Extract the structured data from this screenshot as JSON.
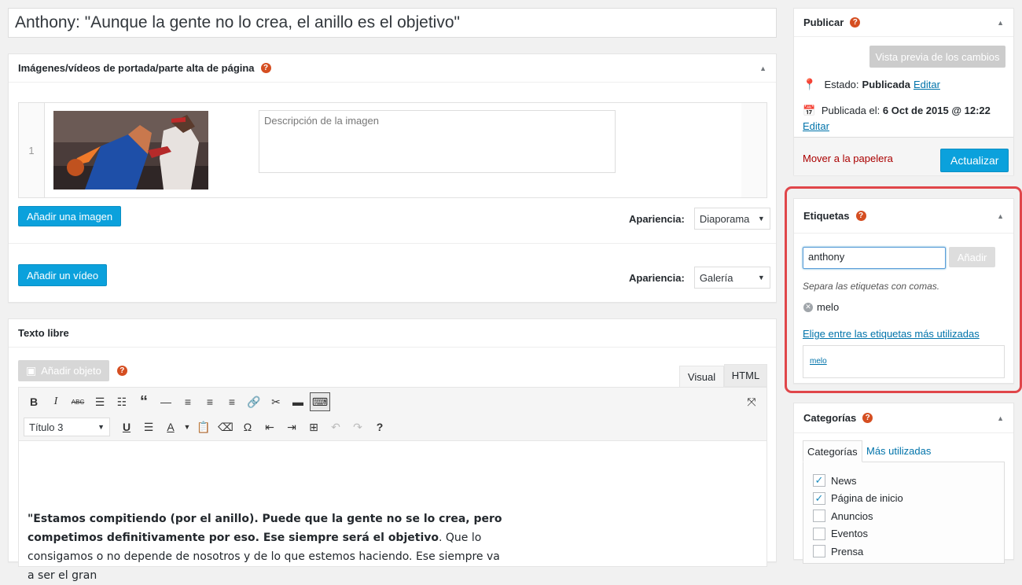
{
  "title": "Anthony: \"Aunque la gente no lo crea, el anillo es el objetivo\"",
  "media_box": {
    "heading": "Imágenes/vídeos de portada/parte alta de página",
    "row_number": "1",
    "description_placeholder": "Descripción de la imagen",
    "add_image": "Añadir una imagen",
    "appearance_label": "Apariencia:",
    "appearance_image": "Diaporama",
    "add_video": "Añadir un vídeo",
    "appearance_video": "Galería"
  },
  "text_box": {
    "heading": "Texto libre",
    "add_object": "Añadir objeto",
    "tab_visual": "Visual",
    "tab_html": "HTML",
    "format_select": "Título 3",
    "content_bold": "\"Estamos compitiendo (por el anillo). Puede que la gente no se lo crea, pero competimos definitivamente por eso. Ese siempre será el objetivo",
    "content_normal": ". Que lo consigamos o no depende de nosotros y de lo que estemos haciendo. Ese siempre va a ser el gran"
  },
  "publish": {
    "heading": "Publicar",
    "preview": "Vista previa de los cambios",
    "status_label": "Estado:",
    "status_value": "Publicada",
    "edit": "Editar",
    "published_label": "Publicada el:",
    "published_value": "6 Oct de 2015 @ 12:22",
    "trash": "Mover a la papelera",
    "update": "Actualizar"
  },
  "tags": {
    "heading": "Etiquetas",
    "input_value": "anthony",
    "add": "Añadir",
    "hint": "Separa las etiquetas con comas.",
    "existing": "melo",
    "most_used_link": "Elige entre las etiquetas más utilizadas",
    "cloud_item": "melo"
  },
  "categories": {
    "heading": "Categorías",
    "tab_all": "Categorías",
    "tab_popular": "Más utilizadas",
    "items": [
      {
        "label": "News",
        "checked": true
      },
      {
        "label": "Página de inicio",
        "checked": true
      },
      {
        "label": "Anuncios",
        "checked": false
      },
      {
        "label": "Eventos",
        "checked": false
      },
      {
        "label": "Prensa",
        "checked": false
      }
    ]
  },
  "colors": {
    "accent": "#0ba1dc",
    "help": "#d54e21",
    "highlight": "#e0464a",
    "trash": "#a00"
  }
}
